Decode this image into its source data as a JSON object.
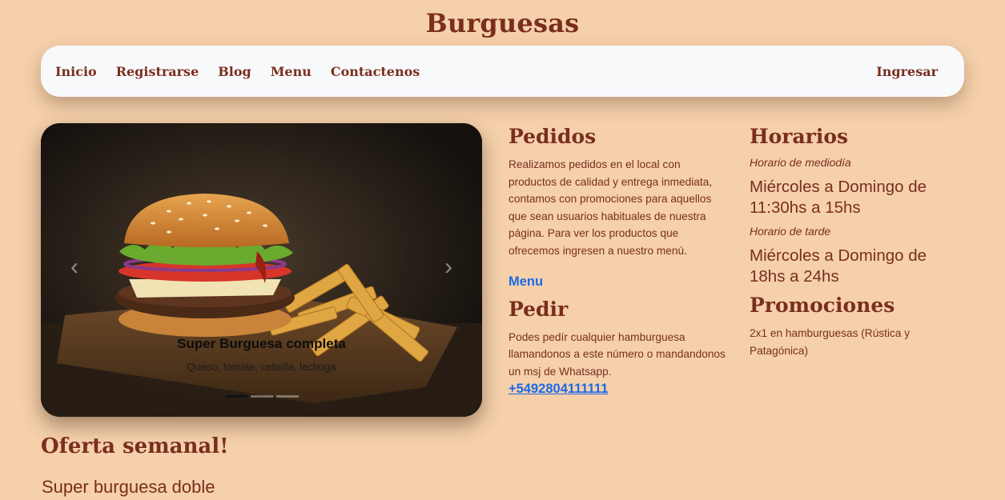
{
  "site": {
    "title": "Burguesas"
  },
  "nav": {
    "links": [
      "Inicio",
      "Registrarse",
      "Blog",
      "Menu",
      "Contactenos"
    ],
    "login": "Ingresar"
  },
  "carousel": {
    "prev_icon": "chevron-left-icon",
    "next_icon": "chevron-right-icon",
    "caption_title": "Super Burguesa completa",
    "caption_text": "Queso, tomate, cebolla, lechuga",
    "active_slide": 1,
    "slide_count": 3
  },
  "pedidos": {
    "heading": "Pedidos",
    "text": "Realizamos pedidos en el local con productos de calidad y entrega inmediata, contamos con promociones para aquellos que sean usuarios habituales de nuestra página. Para ver los productos que ofrecemos ingresen a nuestro menú.",
    "menu_link": "Menu"
  },
  "pedir": {
    "heading": "Pedir",
    "text": "Podes pedír cualquier hamburguesa llamandonos a este número o mandandonos un msj de Whatsapp.",
    "phone": "+5492804111111"
  },
  "horarios": {
    "heading": "Horarios",
    "midday_label": "Horario de mediodía",
    "midday_hours": "Miércoles a Domingo de 11:30hs a 15hs",
    "evening_label": "Horario de tarde",
    "evening_hours": "Miércoles a Domingo de 18hs a 24hs"
  },
  "promociones": {
    "heading": "Promociones",
    "text": "2x1 en hamburguesas (Rústica y Patagónica)"
  },
  "oferta": {
    "heading": "Oferta semanal!",
    "text": "Super burguesa doble"
  },
  "colors": {
    "background": "#f5d0ab",
    "brand": "#7a2e1e",
    "nav_bg": "#f8f9fb",
    "link": "#1a6ae8"
  }
}
